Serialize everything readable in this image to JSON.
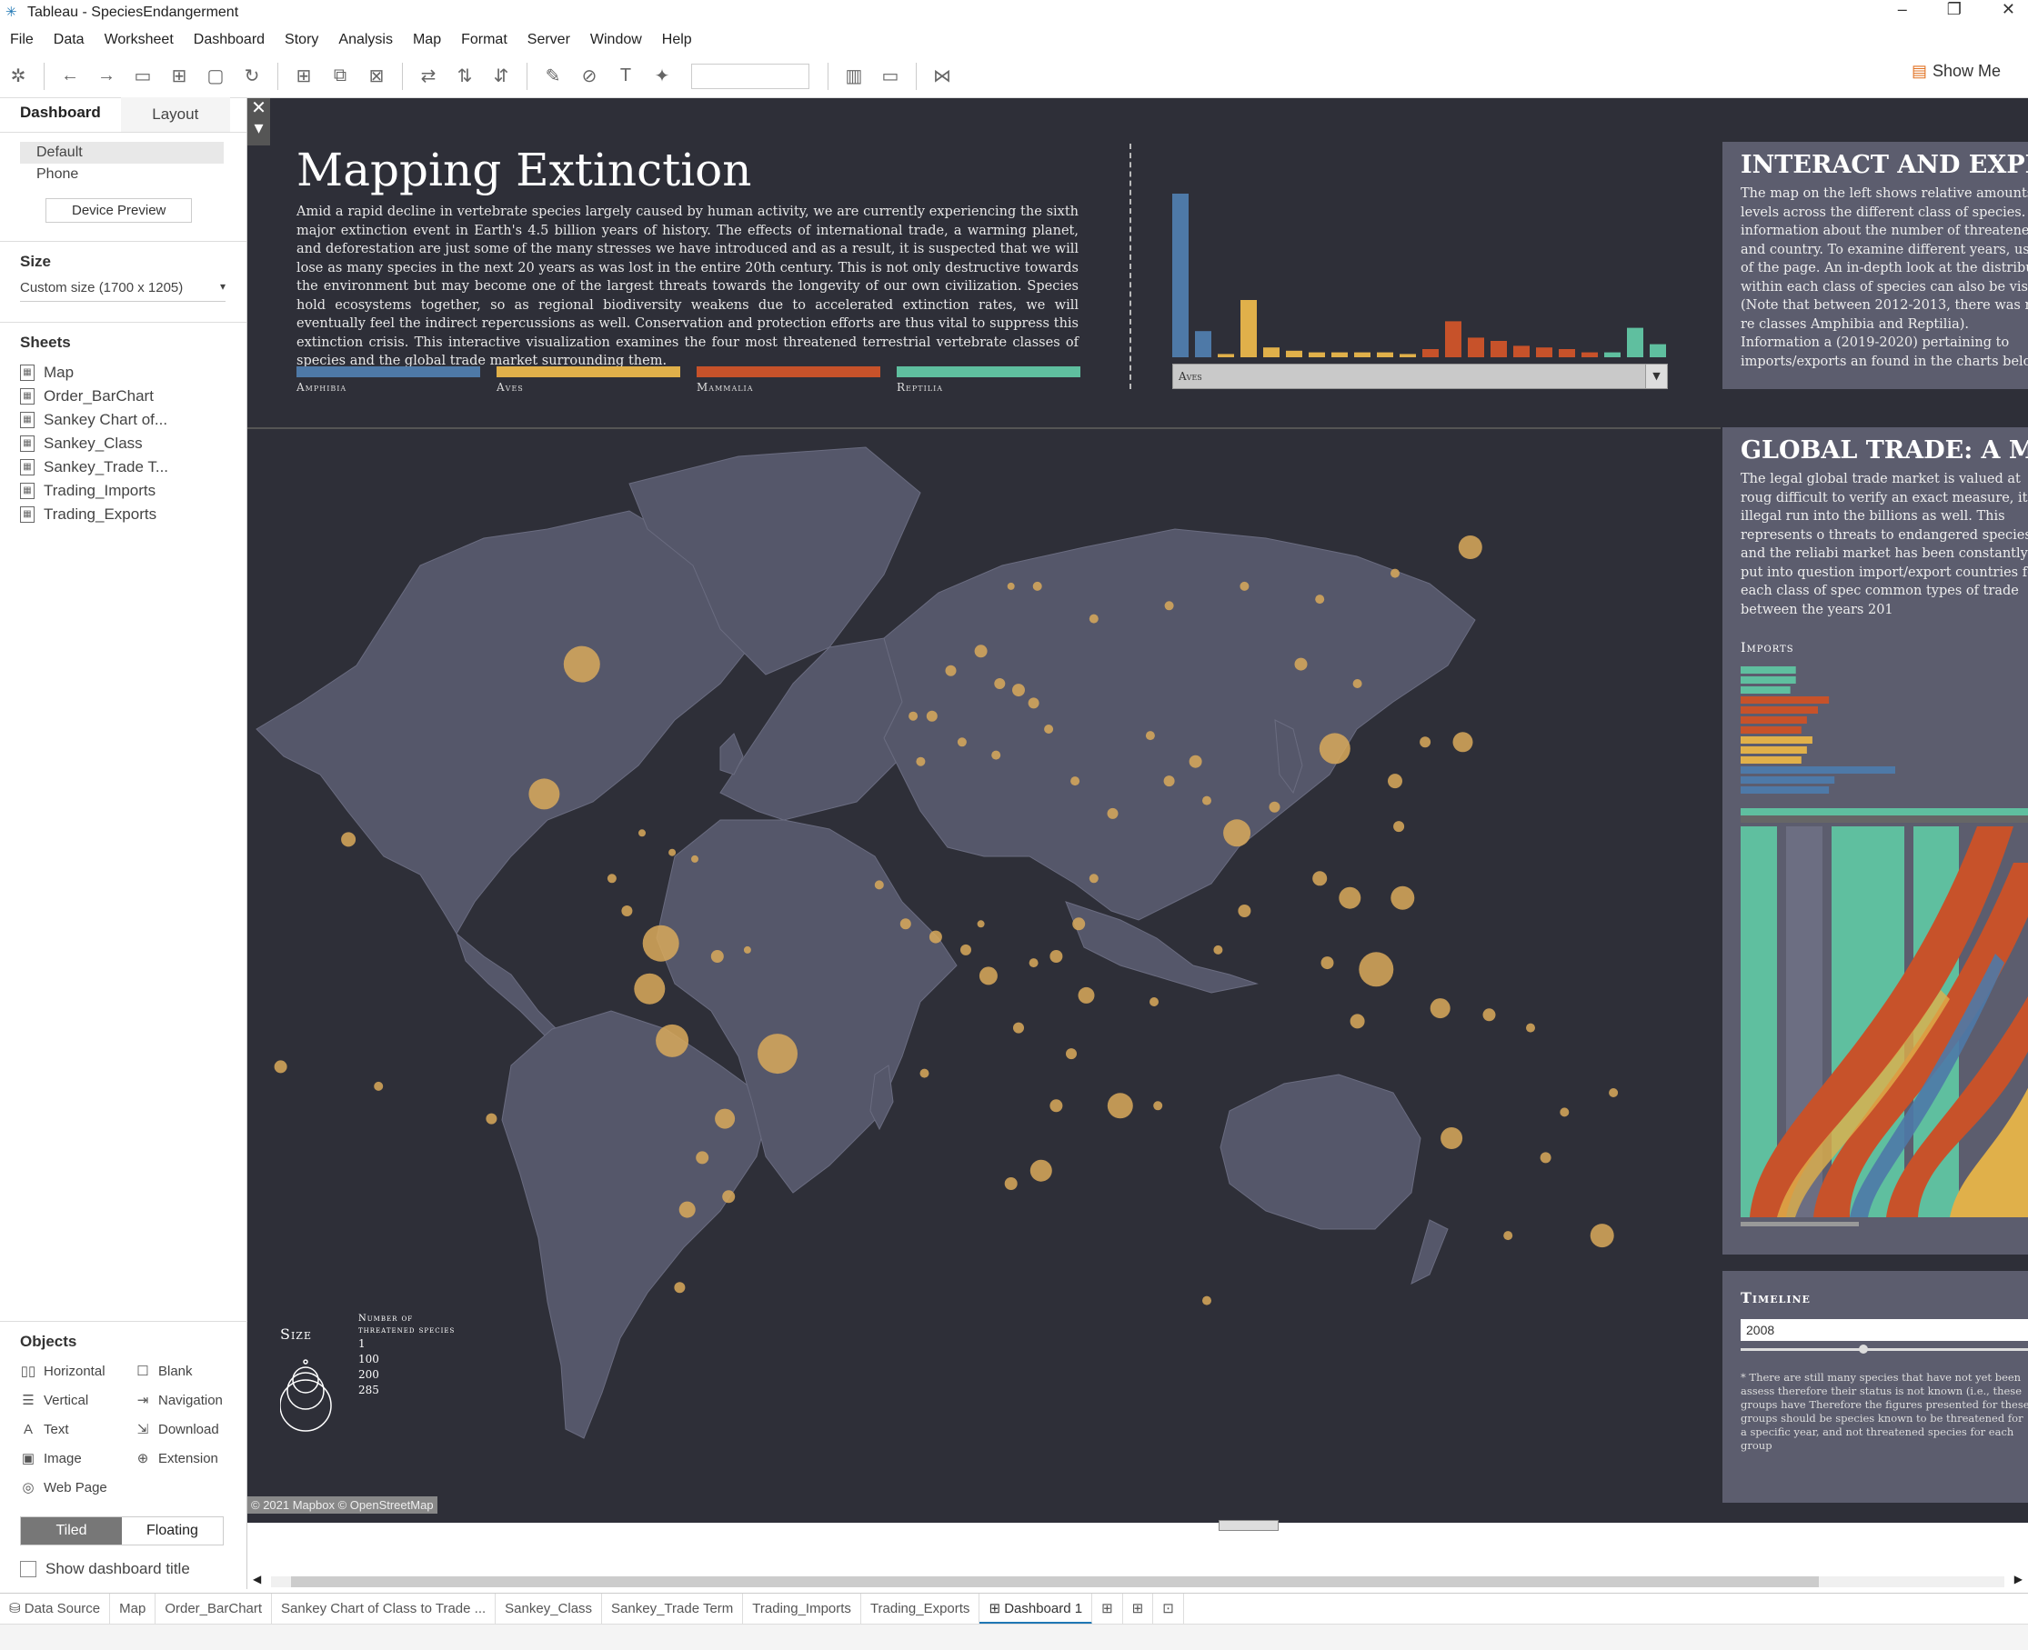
{
  "window": {
    "title": "Tableau - SpeciesEndangerment",
    "controls": [
      "–",
      "❐",
      "✕"
    ]
  },
  "menu": [
    "File",
    "Data",
    "Worksheet",
    "Dashboard",
    "Story",
    "Analysis",
    "Map",
    "Format",
    "Server",
    "Window",
    "Help"
  ],
  "toolbar": {
    "show_me": "Show Me"
  },
  "sidebar": {
    "tab_dashboard": "Dashboard",
    "tab_layout": "Layout",
    "device_default": "Default",
    "device_phone": "Phone",
    "device_preview": "Device Preview",
    "size_header": "Size",
    "size_value": "Custom size (1700 x 1205)",
    "sheets_header": "Sheets",
    "sheets": [
      "Map",
      "Order_BarChart",
      "Sankey Chart of...",
      "Sankey_Class",
      "Sankey_Trade T...",
      "Trading_Imports",
      "Trading_Exports"
    ],
    "objects_header": "Objects",
    "objects": [
      "Horizontal",
      "Blank",
      "Vertical",
      "Navigation",
      "Text",
      "Download",
      "Image",
      "Extension",
      "Web Page"
    ],
    "tiled": "Tiled",
    "floating": "Floating",
    "show_title": "Show dashboard title"
  },
  "dashboard": {
    "title": "Mapping Extinction",
    "intro": "Amid a rapid decline in vertebrate species largely caused by human activity, we are currently experiencing the sixth major extinction event in Earth's 4.5 billion years of history. The effects of international trade, a warming planet, and deforestation are just some of the many stresses we have introduced and as a result, it is suspected that we will lose as many species in the next 20 years as was lost in the entire 20th century. This is not only destructive towards the environment but may become one of the largest threats towards the longevity of our own civilization. Species hold ecosystems together, so as regional biodiversity weakens due to accelerated extinction rates, we will eventually feel the indirect repercussions as well. Conservation and protection efforts are thus vital to suppress this extinction crisis. This interactive visualization examines the four most threatened terrestrial vertebrate classes of species and the global trade market surrounding them.",
    "legend": [
      {
        "label": "Amphibia",
        "color": "#4e79a7"
      },
      {
        "label": "Aves",
        "color": "#e0b04a"
      },
      {
        "label": "Mammalia",
        "color": "#c7522a"
      },
      {
        "label": "Reptilia",
        "color": "#5fbf9f"
      }
    ],
    "class_filter": "Aves",
    "interact_title": "INTERACT AND EXPLO",
    "interact_text": "The map on the left shows relative amounts o levels across the different class of species. Ho information about the number of threatened and country. To examine different years, use t of the page. An in-depth look at the distribut within each class of species can also be visual (Note that between 2012-2013, there was no re classes Amphibia and Reptilia). Information a (2019-2020) pertaining to imports/exports an found in the charts below.",
    "trade_title": "GLOBAL TRADE: A Maj",
    "trade_text": "The legal global trade market is valued at roug difficult to verify an exact measure, its illegal run into the billions as well. This represents o threats to endangered species and the reliabi market has been constantly put into question import/export countries for each class of spec common types of trade between the years 201",
    "imports_label": "Imports",
    "timeline_label": "Timeline",
    "timeline_year": "2008",
    "footnote": "* There are still many species that have not yet been assess therefore their status is not known (i.e., these groups have Therefore the figures presented for these groups should be species known to be threatened for a specific year, and not threatened species for each group",
    "map_attribution": "© 2021 Mapbox © OpenStreetMap",
    "size_legend": {
      "title": "Size",
      "subtitle_1": "Number of",
      "subtitle_2": "threatened species",
      "values": [
        "1",
        "100",
        "200",
        "285"
      ]
    }
  },
  "chart_data": [
    {
      "type": "bar",
      "title": "",
      "series_colors": [
        "#4e79a7",
        "#4e79a7",
        "#e0b04a",
        "#e0b04a",
        "#e0b04a",
        "#e0b04a",
        "#e0b04a",
        "#e0b04a",
        "#e0b04a",
        "#e0b04a",
        "#e0b04a",
        "#c7522a",
        "#c7522a",
        "#c7522a",
        "#c7522a",
        "#c7522a",
        "#c7522a",
        "#c7522a",
        "#c7522a",
        "#5fbf9f",
        "#5fbf9f",
        "#5fbf9f"
      ],
      "values": [
        100,
        16,
        2,
        35,
        6,
        4,
        3,
        3,
        3,
        3,
        2,
        5,
        22,
        12,
        10,
        7,
        6,
        5,
        3,
        3,
        18,
        8,
        1
      ]
    },
    {
      "type": "bar",
      "title": "Imports",
      "colors": [
        "#5fbf9f",
        "#5fbf9f",
        "#5fbf9f",
        "#c7522a",
        "#c7522a",
        "#c7522a",
        "#c7522a",
        "#e0b04a",
        "#e0b04a",
        "#e0b04a",
        "#4e79a7",
        "#4e79a7",
        "#4e79a7"
      ],
      "values": [
        50,
        50,
        45,
        80,
        70,
        60,
        55,
        65,
        60,
        55,
        140,
        85,
        80
      ]
    }
  ],
  "map_points": [
    [
      -96,
      48,
      40
    ],
    [
      -106,
      28,
      34
    ],
    [
      -158,
      21,
      16
    ],
    [
      -176,
      -14,
      14
    ],
    [
      -120,
      -22,
      12
    ],
    [
      -88,
      15,
      10
    ],
    [
      -84,
      10,
      12
    ],
    [
      -80,
      22,
      8
    ],
    [
      -72,
      19,
      8
    ],
    [
      -66,
      18,
      8
    ],
    [
      -75,
      5,
      40
    ],
    [
      -78,
      -2,
      34
    ],
    [
      -72,
      -10,
      36
    ],
    [
      -60,
      3,
      14
    ],
    [
      -52,
      4,
      8
    ],
    [
      -44,
      -12,
      44
    ],
    [
      -58,
      -22,
      22
    ],
    [
      -64,
      -28,
      14
    ],
    [
      -68,
      -36,
      18
    ],
    [
      -70,
      -48,
      12
    ],
    [
      -57,
      -34,
      14
    ],
    [
      -17,
      14,
      10
    ],
    [
      -10,
      8,
      12
    ],
    [
      -2,
      6,
      14
    ],
    [
      6,
      4,
      12
    ],
    [
      10,
      8,
      8
    ],
    [
      12,
      0,
      20
    ],
    [
      20,
      -8,
      12
    ],
    [
      24,
      2,
      10
    ],
    [
      30,
      3,
      14
    ],
    [
      36,
      8,
      14
    ],
    [
      38,
      -3,
      18
    ],
    [
      34,
      -12,
      12
    ],
    [
      30,
      -20,
      14
    ],
    [
      26,
      -30,
      24
    ],
    [
      18,
      -32,
      14
    ],
    [
      47,
      -20,
      28
    ],
    [
      57,
      -20,
      10
    ],
    [
      40,
      15,
      10
    ],
    [
      45,
      25,
      12
    ],
    [
      35,
      30,
      10
    ],
    [
      5,
      36,
      10
    ],
    [
      -6,
      33,
      10
    ],
    [
      14,
      34,
      10
    ],
    [
      -8,
      40,
      10
    ],
    [
      -3,
      40,
      12
    ],
    [
      2,
      47,
      12
    ],
    [
      10,
      50,
      14
    ],
    [
      15,
      45,
      12
    ],
    [
      20,
      44,
      14
    ],
    [
      24,
      42,
      12
    ],
    [
      28,
      38,
      10
    ],
    [
      25,
      60,
      10
    ],
    [
      18,
      60,
      8
    ],
    [
      40,
      55,
      10
    ],
    [
      60,
      57,
      10
    ],
    [
      80,
      60,
      10
    ],
    [
      100,
      58,
      10
    ],
    [
      120,
      62,
      10
    ],
    [
      140,
      66,
      26
    ],
    [
      95,
      48,
      14
    ],
    [
      110,
      45,
      10
    ],
    [
      55,
      37,
      10
    ],
    [
      60,
      30,
      12
    ],
    [
      67,
      33,
      14
    ],
    [
      70,
      27,
      10
    ],
    [
      78,
      22,
      30
    ],
    [
      88,
      26,
      12
    ],
    [
      80,
      10,
      14
    ],
    [
      100,
      15,
      16
    ],
    [
      108,
      12,
      24
    ],
    [
      104,
      35,
      34
    ],
    [
      120,
      30,
      16
    ],
    [
      128,
      36,
      12
    ],
    [
      138,
      36,
      22
    ],
    [
      121,
      23,
      12
    ],
    [
      122,
      12,
      26
    ],
    [
      115,
      1,
      38
    ],
    [
      102,
      2,
      14
    ],
    [
      110,
      -7,
      16
    ],
    [
      132,
      -5,
      22
    ],
    [
      145,
      -6,
      14
    ],
    [
      135,
      -25,
      24
    ],
    [
      165,
      -21,
      10
    ],
    [
      178,
      -18,
      10
    ],
    [
      175,
      -40,
      26
    ],
    [
      156,
      -8,
      10
    ],
    [
      160,
      -28,
      12
    ],
    [
      150,
      -40,
      10
    ],
    [
      70,
      -50,
      10
    ],
    [
      56,
      -4,
      10
    ],
    [
      73,
      4,
      10
    ],
    [
      -150,
      -17,
      10
    ],
    [
      -5,
      -15,
      10
    ]
  ],
  "tabs": [
    "Data Source",
    "Map",
    "Order_BarChart",
    "Sankey Chart of Class to Trade ...",
    "Sankey_Class",
    "Sankey_Trade Term",
    "Trading_Imports",
    "Trading_Exports",
    "Dashboard 1"
  ],
  "icons": {
    "new_worksheet": "new-worksheet-icon",
    "new_dashboard": "new-dashboard-icon",
    "new_story": "new-story-icon"
  }
}
